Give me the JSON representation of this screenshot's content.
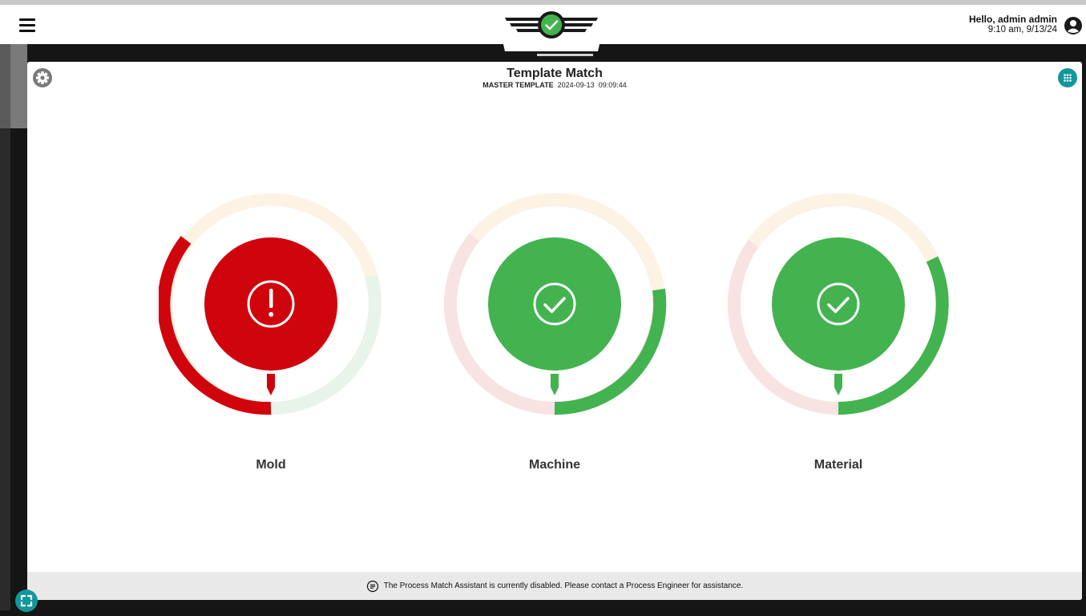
{
  "header": {
    "greeting": "Hello, admin admin",
    "time": "9:10 am, 9/13/24"
  },
  "page": {
    "title": "Template Match",
    "subtitle_label": "MASTER TEMPLATE",
    "subtitle_date": "2024-09-13",
    "subtitle_time": "09:09:44"
  },
  "gauges": [
    {
      "label": "Mold",
      "status": "alert",
      "color": "#d0040c",
      "icon": "exclamation-icon"
    },
    {
      "label": "Machine",
      "status": "ok",
      "color": "#43b34f",
      "icon": "check-icon"
    },
    {
      "label": "Material",
      "status": "ok",
      "color": "#43b34f",
      "icon": "check-icon"
    }
  ],
  "footer": {
    "message": "The Process Match Assistant is currently disabled. Please contact a Process Engineer for assistance."
  },
  "colors": {
    "accent": "#12979b",
    "alert": "#d0040c",
    "ok": "#43b34f",
    "ring_red_faint": "#f8e3e3",
    "ring_yellow_faint": "#fdf3e4",
    "ring_green_faint": "#e8f4ea"
  }
}
